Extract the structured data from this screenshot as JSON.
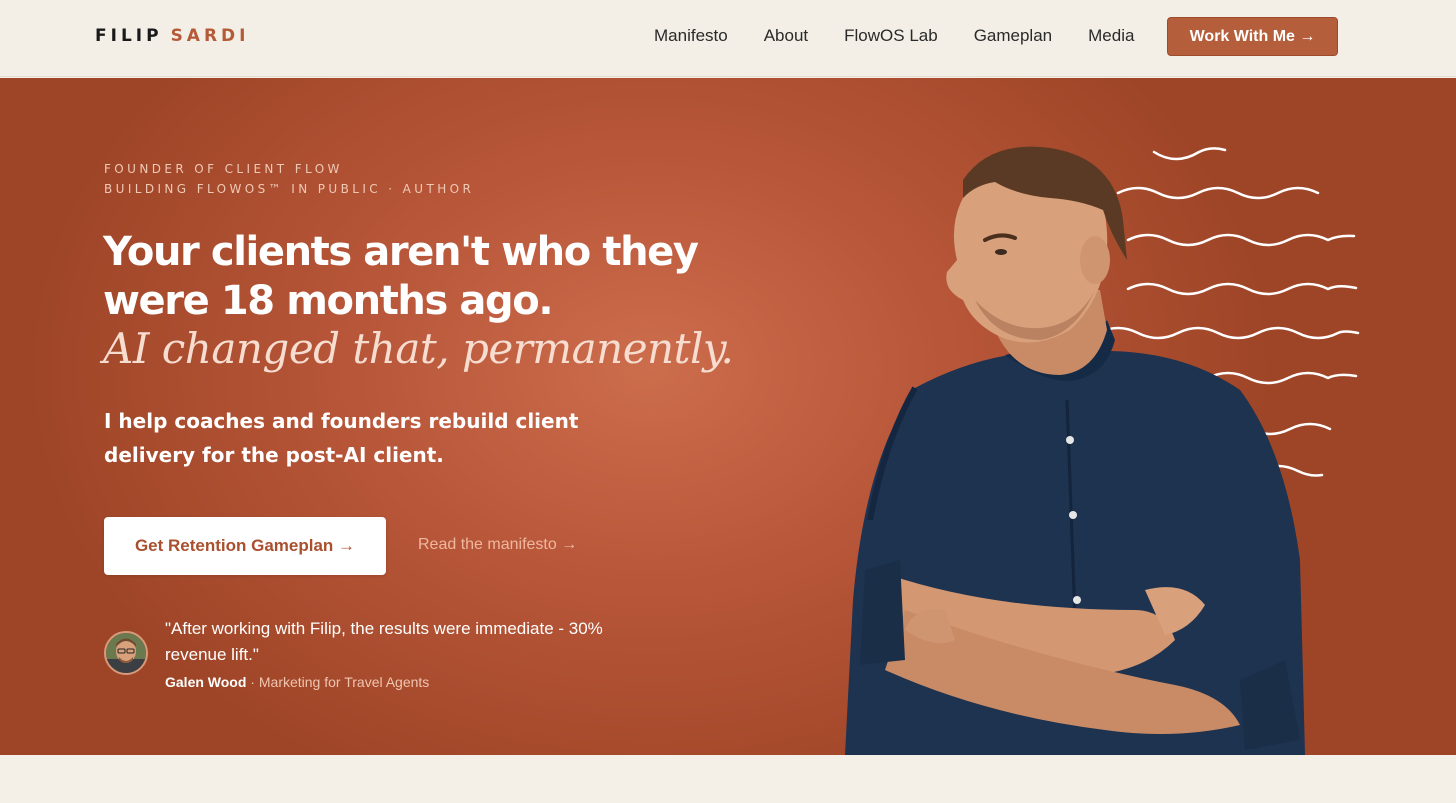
{
  "header": {
    "logo_first": "FILIP",
    "logo_last": "SARDI",
    "nav": [
      "Manifesto",
      "About",
      "FlowOS Lab",
      "Gameplan",
      "Media"
    ],
    "cta_label": "Work With Me →"
  },
  "hero": {
    "eyebrow_line1": "FOUNDER OF CLIENT FLOW",
    "eyebrow_line2": "BUILDING FLOWOS™ IN PUBLIC · AUTHOR",
    "headline_line1": "Your clients aren't who they",
    "headline_line2": "were 18 months ago.",
    "headline_italic": "AI changed that, permanently.",
    "subhead_line1": "I help coaches and founders rebuild client",
    "subhead_line2": "delivery for the post-AI client.",
    "primary_button": "Get Retention Gameplan →",
    "secondary_link": "Read the manifesto →",
    "testimonial": {
      "quote_line1": "\"After working with Filip, the results were immediate - 30%",
      "quote_line2": "revenue lift.\"",
      "name": "Galen Wood",
      "separator": " · ",
      "role": "Marketing for Travel Agents"
    }
  },
  "colors": {
    "accent": "#b55e3c",
    "background": "#f3efe6",
    "hero": "#b9573a",
    "shirt": "#1d3350"
  },
  "icons": {
    "avatar": "testimonial-avatar",
    "decoration": "wave-lines-decoration",
    "photo": "founder-portrait"
  }
}
